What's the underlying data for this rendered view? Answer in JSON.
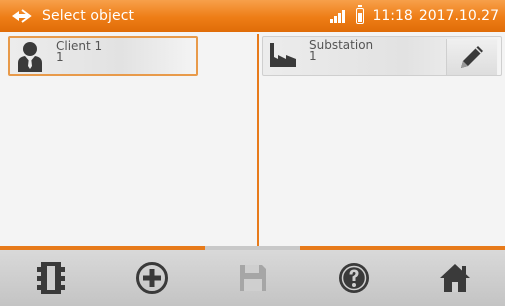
{
  "titlebar": {
    "title": "Select object",
    "time": "11:18",
    "date": "2017.10.27",
    "icons": [
      "app-logo-icon",
      "signal-icon",
      "battery-icon"
    ]
  },
  "objects": [
    {
      "name": "Client 1",
      "number": "1",
      "icon": "person-icon",
      "selected": true
    },
    {
      "name": "Substation",
      "number": "1",
      "icon": "factory-icon",
      "selected": false,
      "edit_icon": "pencil-icon"
    }
  ],
  "toolbar": {
    "icons": [
      "memory-icon",
      "add-icon",
      "save-icon",
      "help-icon",
      "home-icon"
    ],
    "save_enabled": false
  },
  "colors": {
    "accent": "#ee7d16",
    "background": "#f4f4f4",
    "toolbar": "#cfcfcf",
    "icon": "#3a3a3a"
  }
}
